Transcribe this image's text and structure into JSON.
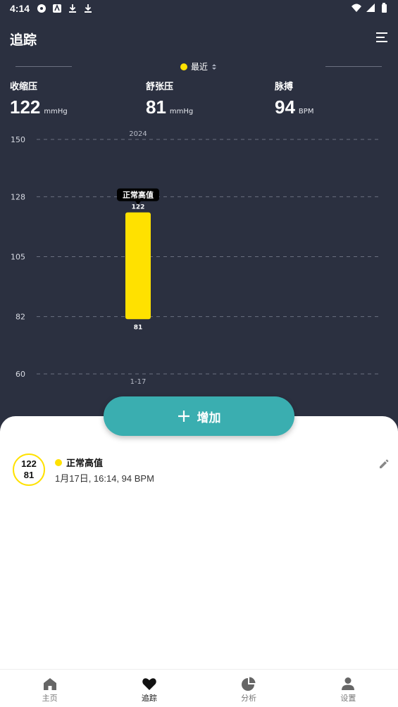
{
  "status_bar": {
    "time": "4:14"
  },
  "header": {
    "title": "追踪"
  },
  "filter": {
    "label": "最近"
  },
  "stats": [
    {
      "label": "收缩压",
      "value": "122",
      "unit": "mmHg"
    },
    {
      "label": "舒张压",
      "value": "81",
      "unit": "mmHg"
    },
    {
      "label": "脉搏",
      "value": "94",
      "unit": "BPM"
    }
  ],
  "chart_data": {
    "type": "bar",
    "year_label": "2024",
    "y_ticks": [
      150,
      128,
      105,
      82,
      60
    ],
    "ylim": [
      60,
      150
    ],
    "grid": true,
    "categories": [
      "1-17"
    ],
    "bars": [
      {
        "category": "1-17",
        "high": 122,
        "low": 81,
        "high_label": "122",
        "low_label": "81",
        "tooltip": "正常高值"
      }
    ],
    "bar_color": "#ffe100"
  },
  "add_button": {
    "label": "增加"
  },
  "records": [
    {
      "systolic": "122",
      "diastolic": "81",
      "status": "正常高值",
      "detail": "1月17日, 16:14, 94 BPM",
      "status_color": "#ffe100"
    }
  ],
  "nav": [
    {
      "label": "主页",
      "icon": "home-icon"
    },
    {
      "label": "追踪",
      "icon": "heart-icon"
    },
    {
      "label": "分析",
      "icon": "pie-chart-icon"
    },
    {
      "label": "设置",
      "icon": "person-icon"
    }
  ]
}
